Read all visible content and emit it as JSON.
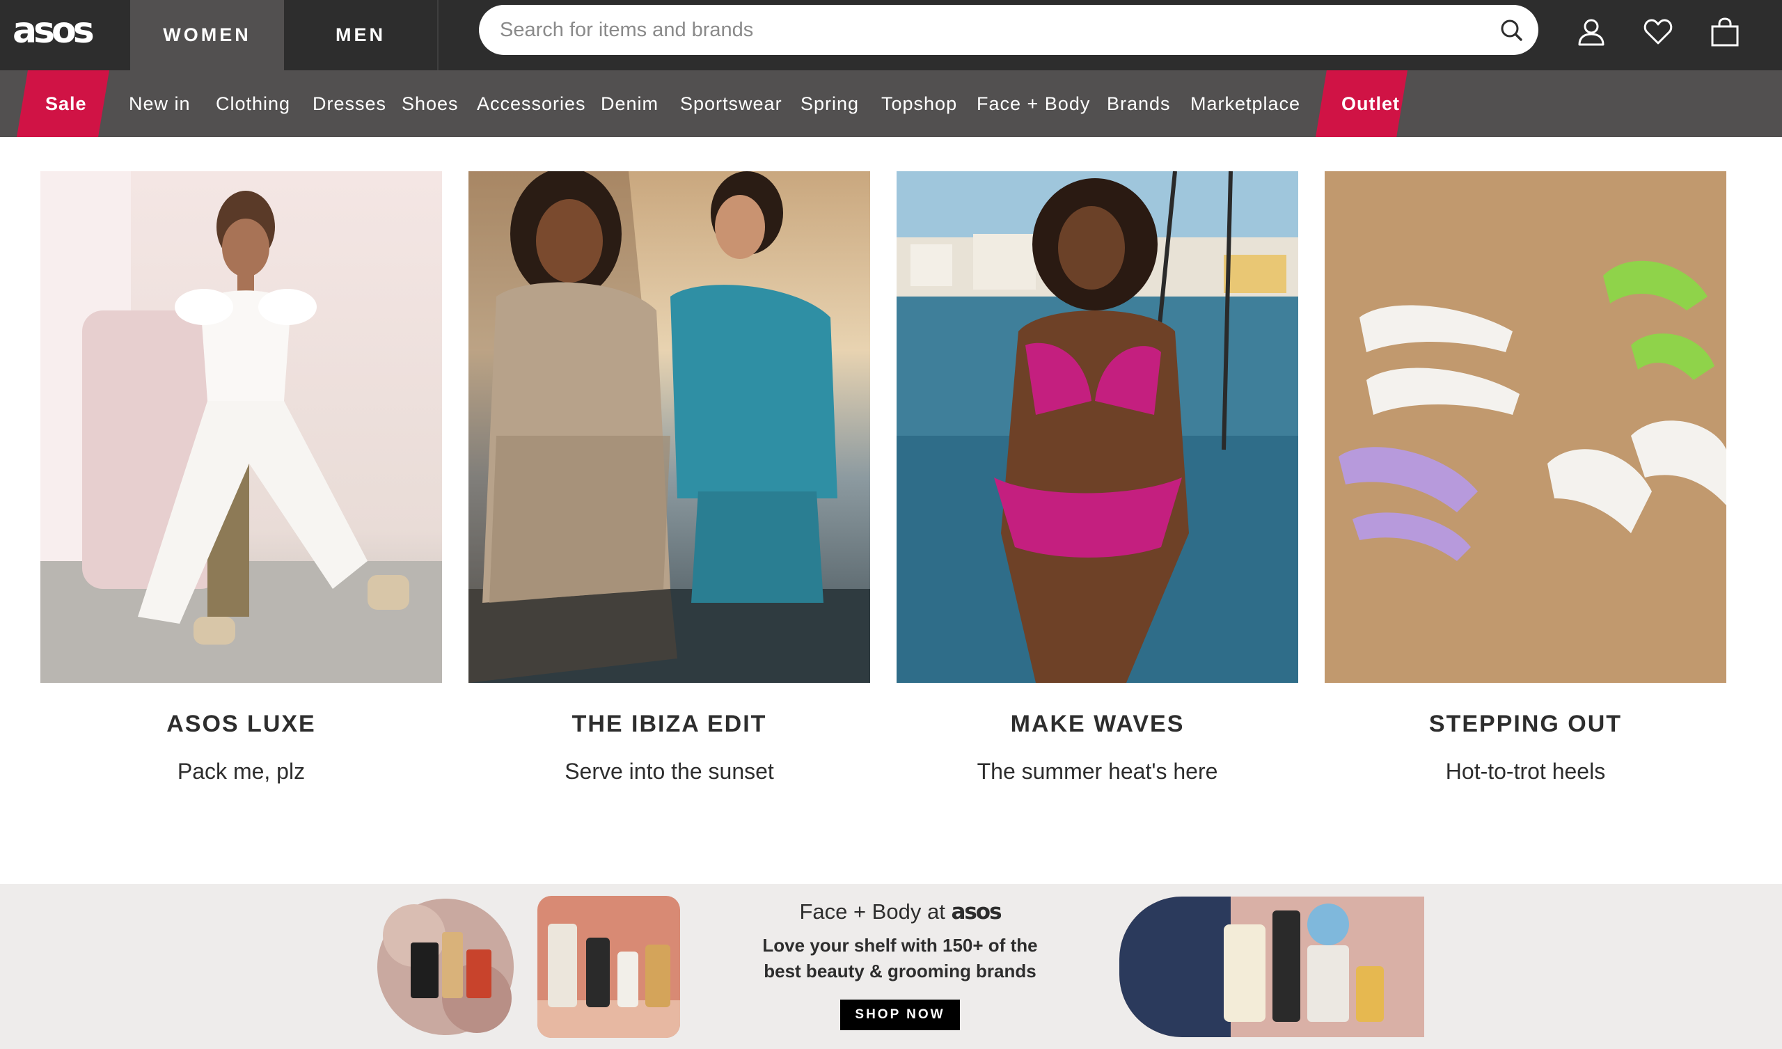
{
  "header": {
    "logo": "asos",
    "tabs": [
      {
        "label": "WOMEN",
        "active": true
      },
      {
        "label": "MEN",
        "active": false
      }
    ],
    "search": {
      "placeholder": "Search for items and brands",
      "value": ""
    },
    "icons": [
      "search-icon",
      "account-icon",
      "saved-items-heart-icon",
      "bag-icon"
    ]
  },
  "nav": {
    "items": [
      "Sale",
      "New in",
      "Clothing",
      "Dresses",
      "Shoes",
      "Accessories",
      "Denim",
      "Sportswear",
      "Spring",
      "Topshop",
      "Face + Body",
      "Brands",
      "Marketplace",
      "Outlet"
    ],
    "highlight_color": "#d01345"
  },
  "features": [
    {
      "title": "ASOS LUXE",
      "subtitle": "Pack me, plz"
    },
    {
      "title": "THE IBIZA EDIT",
      "subtitle": "Serve into the sunset"
    },
    {
      "title": "MAKE WAVES",
      "subtitle": "The summer heat's here"
    },
    {
      "title": "STEPPING OUT",
      "subtitle": "Hot-to-trot heels"
    }
  ],
  "banner": {
    "title_prefix": "Face + Body at",
    "title_brand": "asos",
    "line1": "Love your shelf with 150+ of the",
    "line2": "best beauty & grooming brands",
    "cta": "SHOP NOW"
  },
  "colors": {
    "header_bg": "#2d2d2d",
    "nav_bg": "#525050",
    "sale_red": "#d01345",
    "banner_bg": "#eeeceb"
  }
}
